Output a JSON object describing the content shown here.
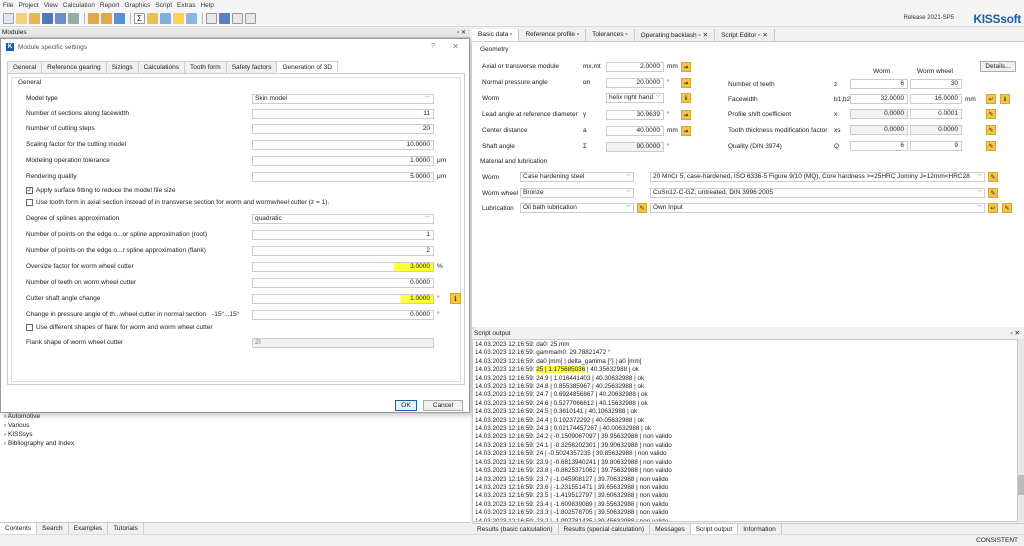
{
  "menubar": [
    "File",
    "Project",
    "View",
    "Calculation",
    "Report",
    "Graphics",
    "Script",
    "Extras",
    "Help"
  ],
  "release": "Release 2021-SP5",
  "logo": "KISSsoft",
  "modules_header": "Modules",
  "tree": [
    "Automotive",
    "Various",
    "KISSsys",
    "Bibliography and Index"
  ],
  "bottom_tabs": [
    "Contents",
    "Search",
    "Examples",
    "Tutorials"
  ],
  "dialog": {
    "title": "Module specific settings",
    "tabs": [
      "General",
      "Reference gearing",
      "Sizings",
      "Calculations",
      "Tooth form",
      "Safety factors",
      "Generation of 3D"
    ],
    "group": "General",
    "model_type_label": "Model type",
    "model_type_value": "Skin model",
    "sections_label": "Number of sections along facewidth",
    "sections_value": "11",
    "cutting_steps_label": "Number of cutting steps",
    "cutting_steps_value": "20",
    "scaling_label": "Scaling factor for the cutting model",
    "scaling_value": "10.0000",
    "tolerance_label": "Modeling operation tolerance",
    "tolerance_value": "1.0000",
    "tolerance_unit": "μm",
    "rendering_label": "Rendering quality",
    "rendering_value": "5.0000",
    "rendering_unit": "μm",
    "chk_surface_label": "Apply surface fitting to reduce the model file size",
    "chk_axial_label": "Use tooth form in axial section instead of in transverse section for worm and wormwheel cutter (z = 1).",
    "degree_label": "Degree of splines approximation",
    "degree_value": "quadratic",
    "points_root_label": "Number of points on the edge o...or spline approximation (root)",
    "points_root_value": "1",
    "points_flank_label": "Number of points on the edge o...r spline approximation (flank)",
    "points_flank_value": "2",
    "oversize_label": "Oversize factor for worm wheel cutter",
    "oversize_value": "3.0000",
    "oversize_unit": "%",
    "teeth_cutter_label": "Number of teeth on worm wheel cutter",
    "teeth_cutter_value": "0.0000",
    "shaft_angle_label": "Cutter shaft angle change",
    "shaft_angle_value": "1.0000",
    "shaft_angle_unit": "°",
    "pressure_change_label": "Change in pressure angle of th...wheel cutter in normal section",
    "pressure_change_range": "-15°...15°",
    "pressure_change_value": "0.0000",
    "pressure_change_unit": "°",
    "chk_flank_label": "Use different shapes of flank for worm and worm wheel cutter",
    "flank_shape_label": "Flank shape of worm wheel cutter",
    "flank_shape_value": "ZI",
    "ok": "OK",
    "cancel": "Cancel",
    "help": "?",
    "close": "✕"
  },
  "right_tabs": [
    "Basic data",
    "Reference profile",
    "Tolerances",
    "Operating backlash",
    "Script Editor"
  ],
  "geometry": {
    "group": "Geometry",
    "module_label": "Axial or transverse module",
    "module_sym": "mx,mt",
    "module_value": "2.0000",
    "module_unit": "mm",
    "pressure_label": "Normal pressure angle",
    "pressure_sym": "αn",
    "pressure_value": "20.0000",
    "pressure_unit": "°",
    "worm_label": "Worm",
    "worm_value": "helix right hand",
    "lead_label": "Lead angle at reference diameter",
    "lead_sym": "γ",
    "lead_value": "30.9639",
    "lead_unit": "°",
    "center_label": "Center distance",
    "center_sym": "a",
    "center_value": "40.0000",
    "center_unit": "mm",
    "shaft_label": "Shaft angle",
    "shaft_sym": "Σ",
    "shaft_value": "90.0000",
    "shaft_unit": "°",
    "col_worm": "Worm",
    "col_wheel": "Worm wheel",
    "details": "Details...",
    "teeth_label": "Number of teeth",
    "teeth_sym": "z",
    "teeth_worm": "6",
    "teeth_wheel": "30",
    "face_label": "Facewidth",
    "face_sym": "b1,b2H",
    "face_worm": "32.0000",
    "face_wheel": "16.0000",
    "face_unit": "mm",
    "shift_label": "Profile shift coefficient",
    "shift_sym": "x",
    "shift_worm": "0.0000",
    "shift_wheel": "0.0001",
    "thick_label": "Tooth thickness modification factor",
    "thick_sym": "xs",
    "thick_worm": "0.0000",
    "thick_wheel": "0.0000",
    "quality_label": "Quality (DIN 3974)",
    "quality_sym": "Q",
    "quality_worm": "6",
    "quality_wheel": "9"
  },
  "material": {
    "group": "Material and lubrication",
    "worm_label": "Worm",
    "worm_mat": "Case hardening steel",
    "worm_spec": "20 MnCr 5, case-hardened, ISO 6336-5 Figure 9/10 (MQ), Core hardness >=25HRC Jominy J=12mm<HRC28",
    "wheel_label": "Worm wheel",
    "wheel_mat": "Bronze",
    "wheel_spec": "CuSn12-C-GZ, untreated, DIN 3996:2005",
    "lub_label": "Lubrication",
    "lub_value": "Oil bath lubrication",
    "lub_spec": "Own Input"
  },
  "script_output": {
    "title": "Script output",
    "lines": [
      "14.03.2023 12:16:59: da0: 25 mm",
      "14.03.2023 12:16:59: gammam0: 29.78821472 °",
      "14.03.2023 12:16:59: da0 [mm] | delta_gamma [°] | a0 [mm]",
      "14.03.2023 12:16:59: 25 | 1.175685036 | 40.35632988 | ok",
      "14.03.2023 12:16:59: 24.9 | 1.016441403 | 40.30632988 | ok",
      "14.03.2023 12:16:59: 24.8 | 0.855385967 | 40.25632988 | ok",
      "14.03.2023 12:16:59: 24.7 | 0.6924856867 | 40.20632988 | ok",
      "14.03.2023 12:16:59: 24.6 | 0.5277066612 | 40.15632988 | ok",
      "14.03.2023 12:16:59: 24.5 | 0.3610141 | 40.10632988 | ok",
      "14.03.2023 12:16:59: 24.4 | 0.192372292 | 40.05632988 | ok",
      "14.03.2023 12:16:59: 24.3 | 0.02174457267 | 40.00632988 | ok",
      "14.03.2023 12:16:59: 24.2 | -0.1509067097 | 39.95632988 | non valido",
      "14.03.2023 12:16:59: 24.1 | -0.3256202301 | 39.90632988 | non valido",
      "14.03.2023 12:16:59: 24 | -0.5024357235 | 39.85632988 | non valido",
      "14.03.2023 12:16:59: 23.9 | -0.6813940241 | 39.80632988 | non valido",
      "14.03.2023 12:16:59: 23.8 | -0.8625371062 | 39.75632988 | non valido",
      "14.03.2023 12:16:59: 23.7 | -1.045908127 | 39.70632988 | non valido",
      "14.03.2023 12:16:59: 23.6 | -1.231551471 | 39.65632988 | non valido",
      "14.03.2023 12:16:59: 23.5 | -1.419512797 | 39.60632988 | non valido",
      "14.03.2023 12:16:59: 23.4 | -1.609839089 | 39.55632988 | non valido",
      "14.03.2023 12:16:59: 23.3 | -1.802578705 | 39.50632988 | non valido",
      "14.03.2023 12:16:59: 23.2 | -1.997781435 | 39.45632988 | non valido"
    ]
  },
  "results_tabs": [
    "Results (basic calculation)",
    "Results (special calculation)",
    "Messages",
    "Script output",
    "Information"
  ],
  "status": "CONSISTENT",
  "colors": {
    "highlight": "#ffff40",
    "accent": "#1a5fa8",
    "button": "#f6c548"
  }
}
